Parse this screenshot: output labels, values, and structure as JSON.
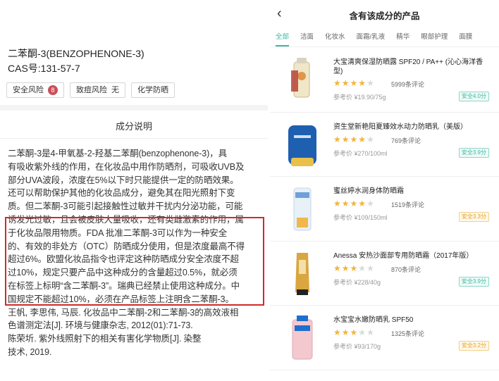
{
  "ingredient": {
    "name": "二苯酮-3(BENZOPHENONE-3)",
    "cas": "CAS号:131-57-7",
    "tags": [
      {
        "label": "安全风险",
        "badge": "8"
      },
      {
        "label": "致痘风险",
        "value": "无"
      },
      {
        "label": "化学防晒"
      }
    ],
    "section_title": "成分说明",
    "description_lines": [
      "二苯酮-3是4-甲氧基-2-羟基二苯酮(benzophenone-3)，具",
      "有吸收紫外线的作用，在化妆品中用作防晒剂，可吸收UVB及",
      "部分UVA波段，浓度在5%以下时只能提供一定的防晒效果。",
      "还可以帮助保护其他的化妆品成分，避免其在阳光照射下变",
      "质。但二苯酮-3可能引起接触性过敏并干扰内分泌功能，可能",
      "诱发光过敏，且会被皮肤大量吸收，还有类雌激素的作用，属",
      "于化妆品限用物质。FDA 批准二苯酮-3可以作为一种安全",
      "的、有效的非处方（OTC）防晒成分使用，但是浓度最高不得",
      "超过6%。欧盟化妆品指令也评定这种防晒成分安全浓度不超",
      "过10%，规定只要产品中这种成分的含量超过0.5%，就必须",
      "在标签上标明“含二苯酮-3”。瑞典已经禁止使用这种成分。中",
      "国规定不能超过10%，必须在产品标签上注明含二苯酮-3。",
      "王帆, 李思伟, 马辰. 化妆品中二苯酮-2和二苯酮-3的高效液相",
      "色谱测定法[J]. 环境与健康杂志, 2012(01):71-73.",
      "陈荣圻. 紫外线照射下的相关有害化学物质[J]. 染整",
      "技术, 2019."
    ]
  },
  "products_page": {
    "back_icon": "chevron-left-icon",
    "title": "含有该成分的产品",
    "tabs": [
      "全部",
      "洁面",
      "化妆水",
      "面霜/乳液",
      "精华",
      "眼部护理",
      "面膜"
    ],
    "active_tab": "全部",
    "accent_color": "#3ab8a3",
    "products": [
      {
        "name": "大宝清爽保湿防晒露 SPF20 / PA++ (沁心海洋香型)",
        "rating": 4,
        "reviews": "5999条评论",
        "price": "参考价 ¥19.90/75g",
        "safety": "安全4.0分",
        "color": "#f0e6c8"
      },
      {
        "name": "资生堂新艳阳夏臻效水动力防晒乳（美版）",
        "rating": 4,
        "reviews": "769条评论",
        "price": "参考价 ¥270/100ml",
        "safety": "安全3.9分",
        "color": "#1f5fb0"
      },
      {
        "name": "蜜丝婷水润身体防晒霜",
        "rating": 4,
        "reviews": "1519条评论",
        "price": "参考价 ¥109/150ml",
        "safety": "安全3.3分",
        "warn": true,
        "color": "#e8f0f8"
      },
      {
        "name": "Anessa 安热沙面部专用防晒霜（2017年版）",
        "rating": 3,
        "reviews": "870条评论",
        "price": "参考价 ¥228/40g",
        "safety": "安全3.9分",
        "color": "#d9a640"
      },
      {
        "name": "水宝宝水嫩防晒乳 SPF50",
        "rating": 3,
        "reviews": "1325条评论",
        "price": "参考价 ¥93/170g",
        "safety": "安全3.2分",
        "warn": true,
        "color": "#f4c8cf"
      }
    ]
  }
}
